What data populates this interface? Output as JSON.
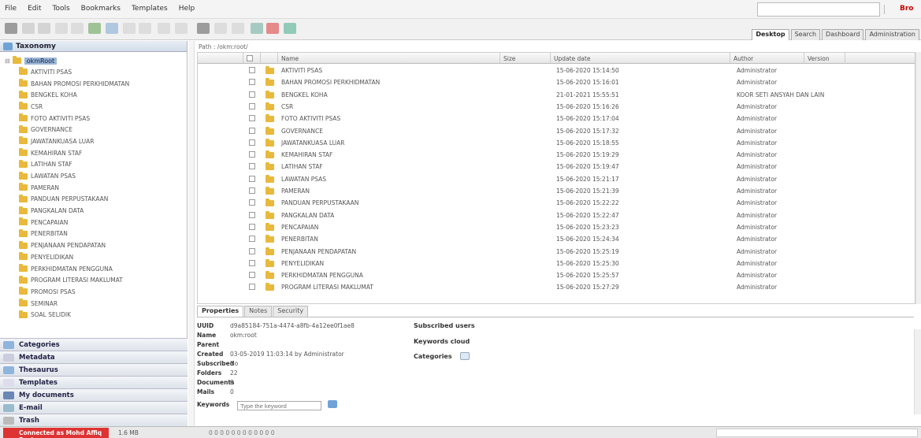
{
  "menubar": {
    "items": [
      "File",
      "Edit",
      "Tools",
      "Bookmarks",
      "Templates",
      "Help"
    ],
    "user": "Bro"
  },
  "toolbar": {
    "tabs": [
      "Desktop",
      "Search",
      "Dashboard",
      "Administration"
    ],
    "active_tab": "Desktop"
  },
  "sidebar": {
    "title": "Taxonomy",
    "root": "okmRoot",
    "items": [
      "AKTIVITI PSAS",
      "BAHAN PROMOSI PERKHIDMATAN",
      "BENGKEL KOHA",
      "CSR",
      "FOTO AKTIVITI PSAS",
      "GOVERNANCE",
      "JAWATANKUASA LUAR",
      "KEMAHIRAN STAF",
      "LATIHAN STAF",
      "LAWATAN PSAS",
      "PAMERAN",
      "PANDUAN PERPUSTAKAAN",
      "PANGKALAN DATA",
      "PENCAPAIAN",
      "PENERBITAN",
      "PENJANAAN PENDAPATAN",
      "PENYELIDIKAN",
      "PERKHIDMATAN PENGGUNA",
      "PROGRAM LITERASI MAKLUMAT",
      "PROMOSI PSAS",
      "SEMINAR",
      "SOAL SELIDIK"
    ],
    "sections": [
      "Categories",
      "Metadata",
      "Thesaurus",
      "Templates",
      "My documents",
      "E-mail",
      "Trash"
    ]
  },
  "main": {
    "path": "Path : /okm:root/",
    "columns": [
      "Name",
      "Size",
      "Update date",
      "Author",
      "Version"
    ],
    "rows": [
      {
        "name": "AKTIVITI PSAS",
        "date": "15-06-2020 15:14:50",
        "author": "Administrator"
      },
      {
        "name": "BAHAN PROMOSI PERKHIDMATAN",
        "date": "15-06-2020 15:16:01",
        "author": "Administrator"
      },
      {
        "name": "BENGKEL KOHA",
        "date": "21-01-2021 15:55:51",
        "author": "KOOR SETI ANSYAH DAN LAIN"
      },
      {
        "name": "CSR",
        "date": "15-06-2020 15:16:26",
        "author": "Administrator"
      },
      {
        "name": "FOTO AKTIVITI PSAS",
        "date": "15-06-2020 15:17:04",
        "author": "Administrator"
      },
      {
        "name": "GOVERNANCE",
        "date": "15-06-2020 15:17:32",
        "author": "Administrator"
      },
      {
        "name": "JAWATANKUASA LUAR",
        "date": "15-06-2020 15:18:55",
        "author": "Administrator"
      },
      {
        "name": "KEMAHIRAN STAF",
        "date": "15-06-2020 15:19:29",
        "author": "Administrator"
      },
      {
        "name": "LATIHAN STAF",
        "date": "15-06-2020 15:19:47",
        "author": "Administrator"
      },
      {
        "name": "LAWATAN PSAS",
        "date": "15-06-2020 15:21:17",
        "author": "Administrator"
      },
      {
        "name": "PAMERAN",
        "date": "15-06-2020 15:21:39",
        "author": "Administrator"
      },
      {
        "name": "PANDUAN PERPUSTAKAAN",
        "date": "15-06-2020 15:22:22",
        "author": "Administrator"
      },
      {
        "name": "PANGKALAN DATA",
        "date": "15-06-2020 15:22:47",
        "author": "Administrator"
      },
      {
        "name": "PENCAPAIAN",
        "date": "15-06-2020 15:23:23",
        "author": "Administrator"
      },
      {
        "name": "PENERBITAN",
        "date": "15-06-2020 15:24:34",
        "author": "Administrator"
      },
      {
        "name": "PENJANAAN PENDAPATAN",
        "date": "15-06-2020 15:25:19",
        "author": "Administrator"
      },
      {
        "name": "PENYELIDIKAN",
        "date": "15-06-2020 15:25:30",
        "author": "Administrator"
      },
      {
        "name": "PERKHIDMATAN PENGGUNA",
        "date": "15-06-2020 15:25:57",
        "author": "Administrator"
      },
      {
        "name": "PROGRAM LITERASI MAKLUMAT",
        "date": "15-06-2020 15:27:29",
        "author": "Administrator"
      }
    ]
  },
  "properties": {
    "tabs": [
      "Properties",
      "Notes",
      "Security"
    ],
    "uuid": "d9a85184-751a-4474-a8fb-4a12ee0f1ae8",
    "name": "okm:root",
    "parent": "",
    "created": "03-05-2019 11:03:14 by Administrator",
    "subscribed": "No",
    "folders": "22",
    "documents": "0",
    "mails": "0",
    "keyword_placeholder": "Type the keyword",
    "labels": {
      "uuid": "UUID",
      "name": "Name",
      "parent": "Parent",
      "created": "Created",
      "subscribed": "Subscribed",
      "folders": "Folders",
      "documents": "Documents",
      "mails": "Mails",
      "keywords": "Keywords"
    },
    "subscribed_users": "Subscribed users",
    "keywords_cloud": "Keywords cloud",
    "categories": "Categories"
  },
  "statusbar": {
    "connection": "Connected as Mohd Affiq Rosly",
    "memory": "1.6 MB",
    "queue": "0 0 0 0 0 0 0 0 0 0 0 0"
  },
  "colors": {
    "accent": "#6fa3d8",
    "folder": "#e8b93c",
    "connection_bg": "#d33333"
  }
}
